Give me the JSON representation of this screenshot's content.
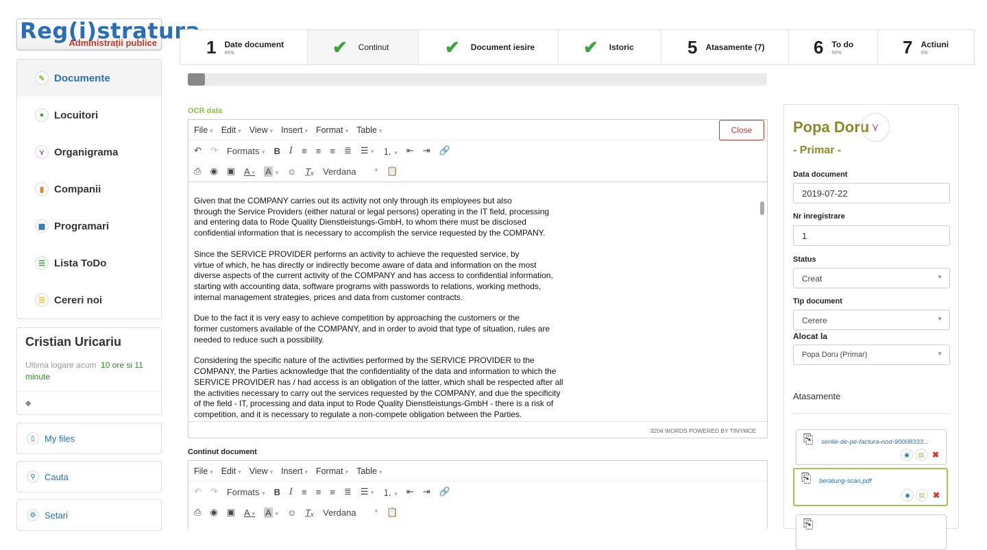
{
  "logo": {
    "main": "Reg(i)stratura",
    "sub": "Administrații publice"
  },
  "sidebar": {
    "items": [
      {
        "label": "Documente",
        "icon": "paperclip-icon",
        "color": "#8bc34a"
      },
      {
        "label": "Locuitori",
        "icon": "user-icon",
        "color": "#3aa53a"
      },
      {
        "label": "Organigrama",
        "icon": "org-chart-icon",
        "color": "#9b59b6"
      },
      {
        "label": "Companii",
        "icon": "building-icon",
        "color": "#e67e22"
      },
      {
        "label": "Programari",
        "icon": "calendar-icon",
        "color": "#2a6fb5"
      },
      {
        "label": "Lista ToDo",
        "icon": "list-icon",
        "color": "#3aa53a"
      },
      {
        "label": "Cereri noi",
        "icon": "list-icon",
        "color": "#f1c40f"
      }
    ]
  },
  "user": {
    "name": "Cristian Uricariu",
    "last_login_prefix": "Ultima logare acum",
    "last_login_value": "10 ore si 11 minute"
  },
  "side_buttons": [
    {
      "label": "My files",
      "icon": "file-icon"
    },
    {
      "label": "Cauta",
      "icon": "search-icon"
    },
    {
      "label": "Setari",
      "icon": "gear-icon"
    }
  ],
  "stepper": {
    "steps": [
      {
        "num": "1",
        "label": "Date document",
        "pct": "45%"
      },
      {
        "label": "Continut",
        "done": true
      },
      {
        "label": "Document iesire",
        "done": true
      },
      {
        "label": "Istoric",
        "done": true
      },
      {
        "num": "5",
        "label": "Atasamente (7)"
      },
      {
        "num": "6",
        "label": "To do",
        "pct": "50%"
      },
      {
        "num": "7",
        "label": "Actiuni",
        "pct": "0%"
      }
    ]
  },
  "progress": {
    "fraction": 0.03
  },
  "ocr": {
    "title": "OCR data",
    "menu": [
      "File",
      "Edit",
      "View",
      "Insert",
      "Format",
      "Table"
    ],
    "close_label": "Close",
    "formats_label": "Formats",
    "font_label": "Verdana",
    "paragraphs": [
      "Given that the COMPANY carries out its activity not only through its employees but also\nthrough the Service Providers (either natural or legal persons) operating in the IT field, processing\nand entering data to Rode Quality Dienstleistungs-GmbH, to whom there must be disclosed\nconfidential information that is necessary to accomplish the service requested by the COMPANY.",
      "Since the SERVICE PROVIDER performs an activity to achieve the requested service, by\nvirtue of which, he has directly or indirectly become aware of data and information on the most\ndiverse aspects of the current activity of the COMPANY and has access to confidential information,\nstarting with accounting data, software programs with passwords to relations, working methods,\ninternal management strategies, prices and data from customer contracts.",
      "Due to the fact it is very easy to achieve competition by approaching the customers or the\nformer customers available of the COMPANY, and in order to avoid that type of situation, rules are\nneeded to reduce such a possibility.",
      "Considering the specific nature of the activities performed by the SERVICE PROVIDER to the\nCOMPANY, the Parties acknowledge that the confidentiality of the data and information to which the\nSERVICE PROVIDER has / had access is an obligation of the latter, which shall be respected after all\nthe activities necessary to carry out the services requested by the COMPANY, and due the specificity\nof the field - IT, processing and data input to Rode Quality Dienstleistungs-GmbH - there is a risk of\ncompetition, and it is necessary to regulate a non-compete obligation between the Parties."
    ],
    "status": "3204 WORDS POWERED BY TINYMCE"
  },
  "continut": {
    "title": "Continut document",
    "menu": [
      "File",
      "Edit",
      "View",
      "Insert",
      "Format",
      "Table"
    ],
    "formats_label": "Formats",
    "font_label": "Verdana"
  },
  "panel": {
    "name": "Popa Doru",
    "role": "- Primar -",
    "date_label": "Data document",
    "date_value": "2019-07-22",
    "nr_label": "Nr inregistrare",
    "nr_value": "1",
    "status_label": "Status",
    "status_value": "Creat",
    "tip_label": "Tip document",
    "tip_value": "Cerere",
    "alocat_label": "Alocat la",
    "alocat_value": "Popa Doru (Primar)",
    "att_title": "Atasamente",
    "attachments": [
      {
        "name": "seriile-de-pe-factura-nod-90008333..."
      },
      {
        "name": "beratung-scan.pdf",
        "highlighted": true
      }
    ]
  }
}
